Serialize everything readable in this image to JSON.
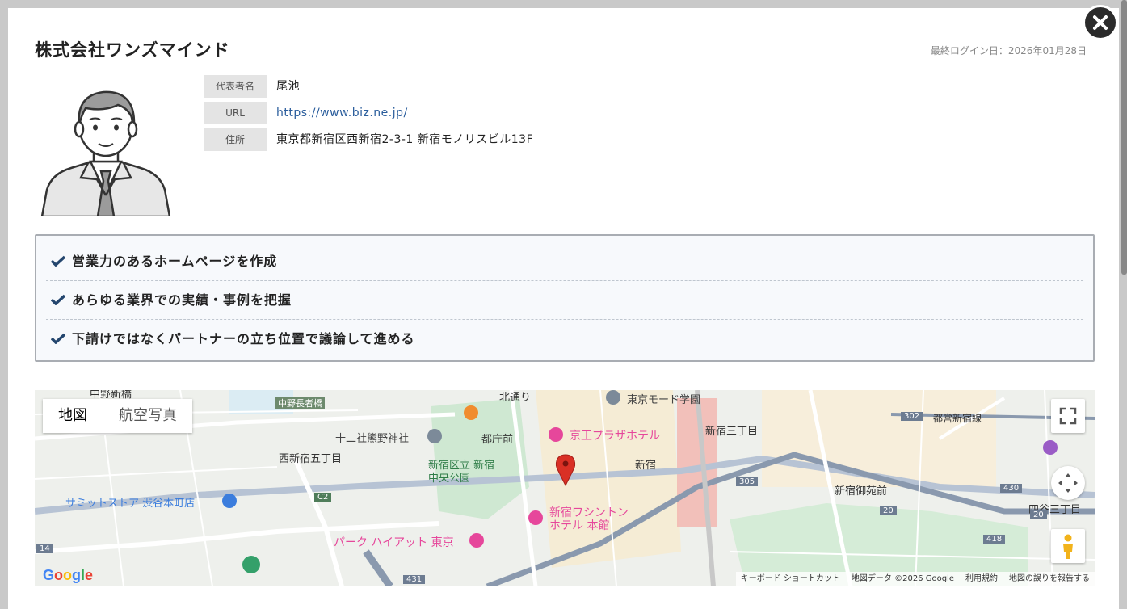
{
  "close": {
    "icon": "close-icon"
  },
  "company": {
    "name": "株式会社ワンズマインド",
    "last_login": "最終ログイン日：2026年01月28日"
  },
  "info": [
    {
      "label": "代表者名",
      "value": "尾池"
    },
    {
      "label": "URL",
      "value": "https://www.biz.ne.jp/"
    },
    {
      "label": "住所",
      "value": "東京都新宿区西新宿2-3-1 新宿モノリスビル13F"
    }
  ],
  "features": [
    "営業力のあるホームページを作成",
    "あらゆる業界での実績・事例を把握",
    "下請けではなくパートナーの立ち位置で議論して進める"
  ],
  "map": {
    "type_map": "地図",
    "type_satellite": "航空写真",
    "labels": {
      "nakano_shimbashi": "中野新橋",
      "nakano_chojabashi": "中野長者橋",
      "kitadori": "北通り",
      "mode_gakuen": "東京モード学園",
      "kumano": "十二社熊野神社",
      "tochomae": "都庁前",
      "keio_plaza": "京王プラザホテル",
      "shinjuku_sanchome": "新宿三丁目",
      "nishishinjuku_gochome": "西新宿五丁目",
      "chuo_park": "新宿区立 新宿\n中央公園",
      "shinjuku": "新宿",
      "summit": "サミットストア 渋谷本町店",
      "gyoenmae": "新宿御苑前",
      "washington": "新宿ワシントン\nホテル 本館",
      "park_hyatt": "パーク ハイアット 東京",
      "yotsuya": "四谷三丁目",
      "toei_line": "都営新宿線",
      "route_302": "302",
      "route_305": "305",
      "route_430": "430",
      "route_20": "20",
      "route_20b": "20",
      "route_418": "418",
      "route_431": "431",
      "route_14": "14",
      "route_c2": "C2"
    },
    "attribution": {
      "shortcuts": "キーボード ショートカット",
      "data": "地図データ ©2026 Google",
      "terms": "利用規約",
      "report": "地図の誤りを報告する"
    },
    "logo": "Google"
  },
  "colors": {
    "accent": "#2a5d9c",
    "check": "#24466e",
    "poi_pink": "#e6479b",
    "pin_red": "#d93025"
  }
}
